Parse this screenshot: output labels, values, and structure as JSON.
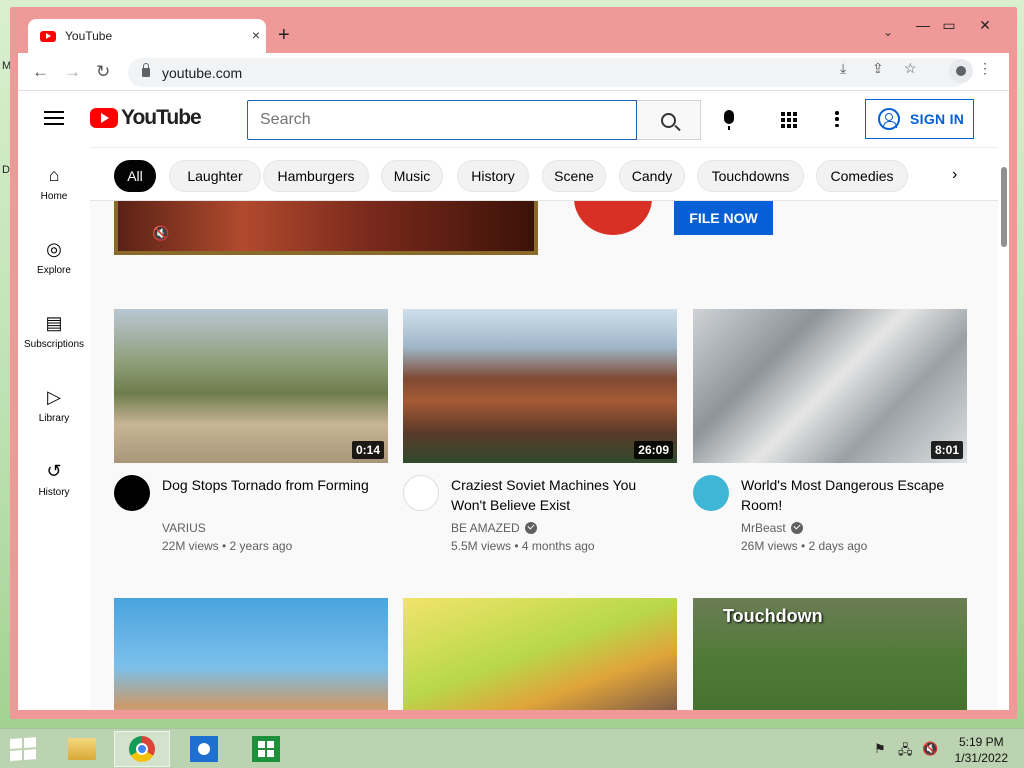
{
  "desktop": {
    "edge_letters": [
      "M",
      "D"
    ]
  },
  "window": {
    "tab_title": "YouTube",
    "tab_close": "×",
    "new_tab": "+",
    "tab_search": "⌄",
    "controls": {
      "minimize": "—",
      "maximize": "▭",
      "close": "✕"
    }
  },
  "toolbar": {
    "back": "←",
    "forward": "→",
    "reload": "↻",
    "url": "youtube.com",
    "install_icon": "⤓",
    "share_icon": "⇪",
    "bookmark_icon": "☆",
    "menu_icon": "⋮"
  },
  "youtube": {
    "logo_text": "YouTube",
    "search_placeholder": "Search",
    "sign_in": "SIGN IN",
    "guide": [
      {
        "label": "Home",
        "icon": "⌂"
      },
      {
        "label": "Explore",
        "icon": "◎"
      },
      {
        "label": "Subscriptions",
        "icon": "▤"
      },
      {
        "label": "Library",
        "icon": "▷"
      },
      {
        "label": "History",
        "icon": "↺"
      }
    ],
    "chips": [
      "All",
      "Laughter",
      "Hamburgers",
      "Music",
      "History",
      "Scene",
      "Candy",
      "Touchdowns",
      "Comedies"
    ],
    "chip_next": "›",
    "ad": {
      "cta": "FILE NOW",
      "mute_icon": "🔇"
    },
    "videos": [
      {
        "title": "Dog Stops Tornado from Forming",
        "channel": "VARIUS",
        "verified": false,
        "stats": "22M views • 2 years ago",
        "duration": "0:14",
        "avatar_color": "#000000",
        "thumb": "linear-gradient(180deg,#b9c7d4 0%,#8e9e78 35%,#6f7d4c 55%,#c8b596 75%,#a89678 100%)"
      },
      {
        "title": "Craziest Soviet Machines You Won't Believe Exist",
        "channel": "BE AMAZED",
        "verified": true,
        "stats": "5.5M views • 4 months ago",
        "duration": "26:09",
        "avatar_color": "#ffffff",
        "thumb": "linear-gradient(180deg,#cfe0ec 0%,#9fb6c8 25%,#7f4a33 45%,#a55a35 60%,#5b3a2a 80%,#2f4a2c 100%)"
      },
      {
        "title": "World's Most Dangerous Escape Room!",
        "channel": "MrBeast",
        "verified": true,
        "stats": "26M views • 2 days ago",
        "duration": "8:01",
        "avatar_color": "#3fb6d6",
        "thumb": "linear-gradient(135deg,#cfd3d6 0%,#8e9499 30%,#e6e6e6 50%,#9aa1a6 70%,#dfe2e4 100%)"
      }
    ],
    "row2_thumbs": [
      "linear-gradient(180deg,#4aa3e0 0%,#7cc0ea 45%,#c99a6e 70%,#e8d2c0 100%)",
      "linear-gradient(160deg,#f2e46a 0%,#b8d84a 40%,#e0a43a 60%,#3b2a50 100%)",
      "linear-gradient(180deg,#6b7d55 0%,#4f7a36 40%,#3f6b2a 100%)"
    ],
    "row2_caption": "Touchdown"
  },
  "taskbar": {
    "time": "5:19 PM",
    "date": "1/31/2022",
    "tray_icons": [
      "⚑",
      "🖧",
      "🔇"
    ]
  }
}
